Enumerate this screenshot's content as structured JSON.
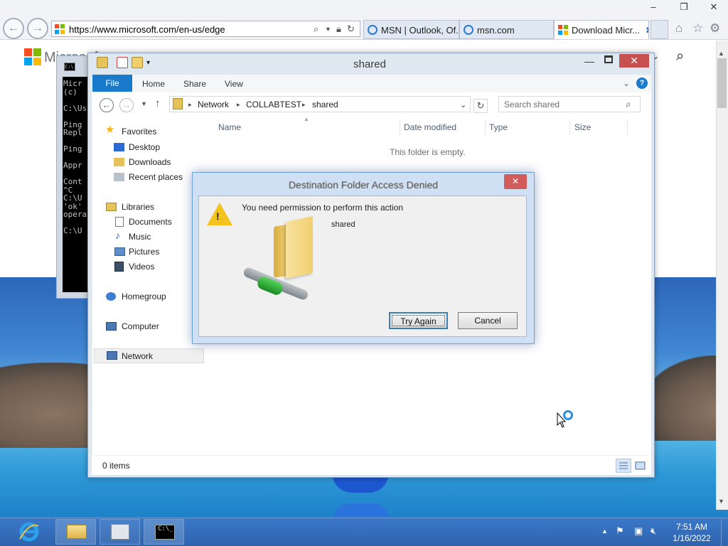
{
  "browser": {
    "url": "https://www.microsoft.com/en-us/edge",
    "tabs": [
      {
        "label": "MSN | Outlook, Of..."
      },
      {
        "label": "msn.com"
      },
      {
        "label": "Download Micr..."
      }
    ],
    "page_logo_text": "Microsoft"
  },
  "cmd": {
    "lines": "Micr\n(c) \n\nC:\\Us\n\nPing\nRepl\n\nPing\n\nAppr\n\nCont\n^C\nC:\\U\n'ok'\nopera\n\nC:\\U"
  },
  "explorer": {
    "title": "shared",
    "ribbon_tabs": [
      "File",
      "Home",
      "Share",
      "View"
    ],
    "breadcrumb": [
      "Network",
      "COLLABTEST",
      "shared"
    ],
    "search_placeholder": "Search shared",
    "nav": {
      "favorites": "Favorites",
      "favorites_items": [
        "Desktop",
        "Downloads",
        "Recent places"
      ],
      "libraries": "Libraries",
      "libraries_items": [
        "Documents",
        "Music",
        "Pictures",
        "Videos"
      ],
      "homegroup": "Homegroup",
      "computer": "Computer",
      "network": "Network"
    },
    "columns": [
      "Name",
      "Date modified",
      "Type",
      "Size"
    ],
    "empty_message": "This folder is empty.",
    "status": "0 items"
  },
  "dialog": {
    "title": "Destination Folder Access Denied",
    "message": "You need permission to perform this action",
    "item_name": "shared",
    "try_again": "Try Again",
    "cancel": "Cancel"
  },
  "taskbar": {
    "time": "7:51 AM",
    "date": "1/16/2022"
  }
}
